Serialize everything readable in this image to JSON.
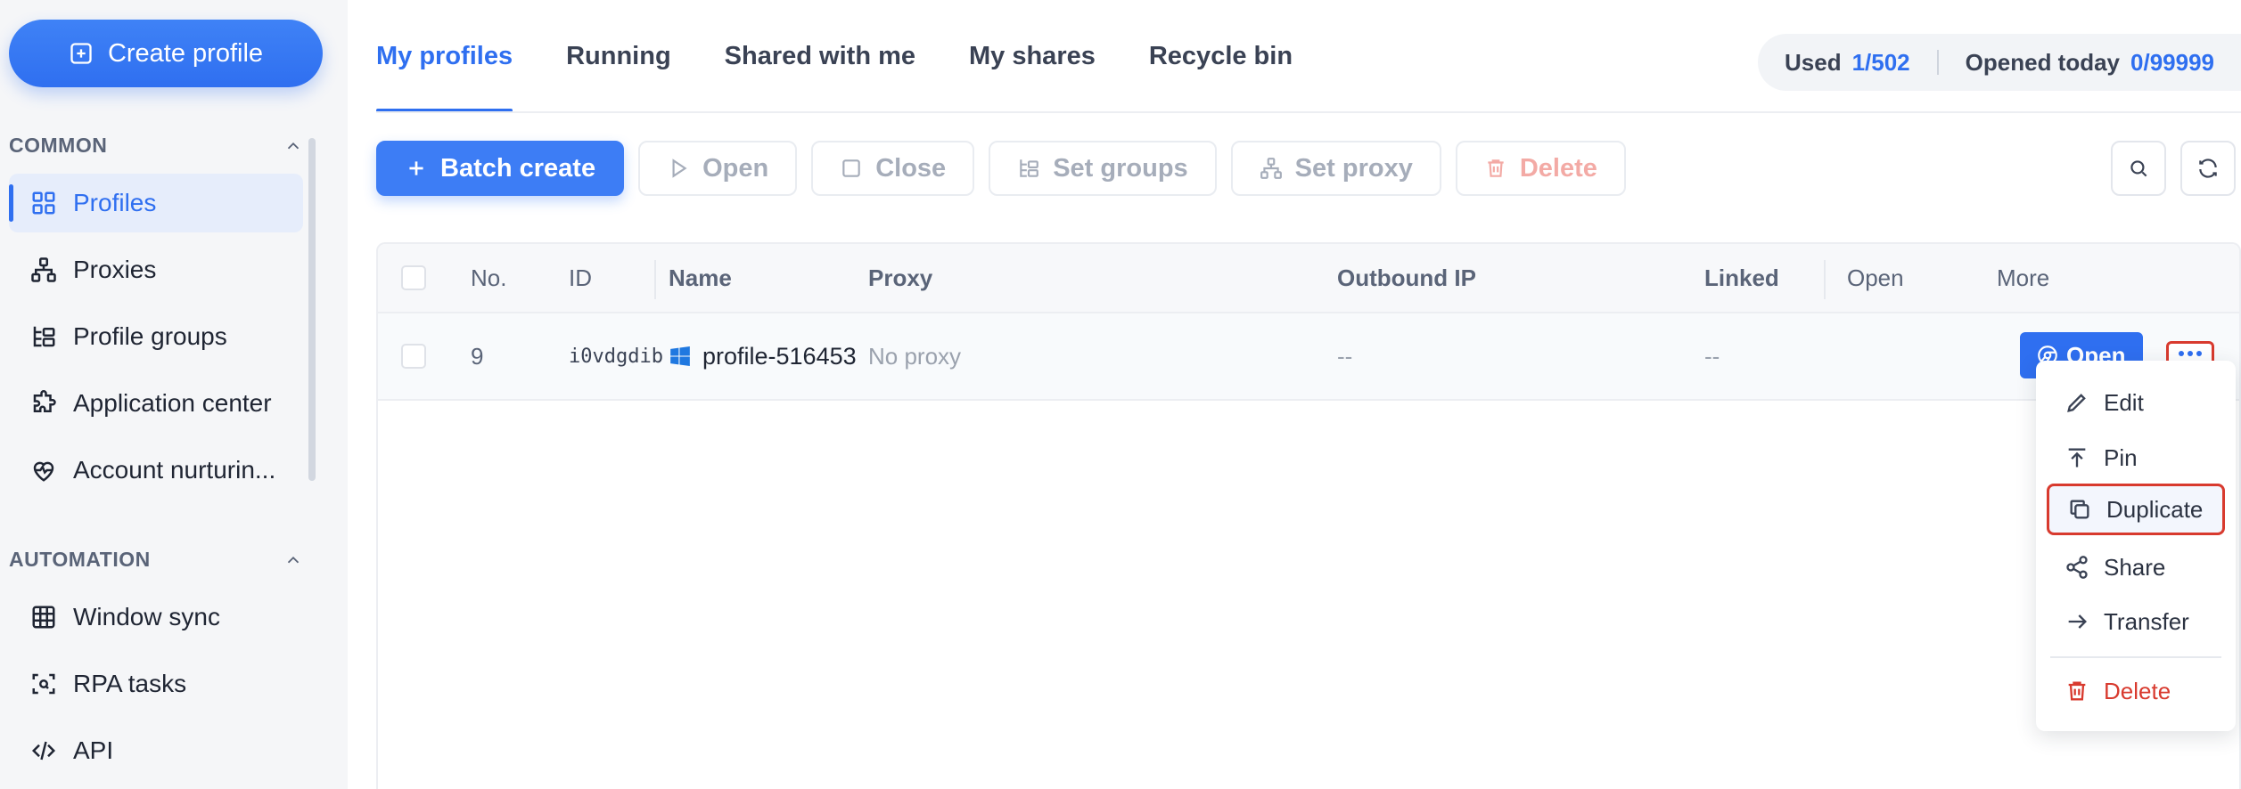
{
  "sidebar": {
    "create_label": "Create profile",
    "sections": [
      {
        "title": "COMMON",
        "items": [
          {
            "label": "Profiles",
            "icon": "grid-icon",
            "active": true
          },
          {
            "label": "Proxies",
            "icon": "network-icon"
          },
          {
            "label": "Profile groups",
            "icon": "groups-icon"
          },
          {
            "label": "Application center",
            "icon": "puzzle-icon"
          },
          {
            "label": "Account nurturin...",
            "icon": "heart-pulse-icon"
          }
        ]
      },
      {
        "title": "AUTOMATION",
        "items": [
          {
            "label": "Window sync",
            "icon": "window-grid-icon"
          },
          {
            "label": "RPA tasks",
            "icon": "scan-icon"
          },
          {
            "label": "API",
            "icon": "code-icon"
          }
        ]
      }
    ]
  },
  "tabs": [
    "My profiles",
    "Running",
    "Shared with me",
    "My shares",
    "Recycle bin"
  ],
  "usage": {
    "used_label": "Used",
    "used_value": "1/502",
    "opened_label": "Opened today",
    "opened_value": "0/99999"
  },
  "toolbar": {
    "batch_create": "Batch create",
    "open": "Open",
    "close": "Close",
    "set_groups": "Set groups",
    "set_proxy": "Set proxy",
    "delete": "Delete"
  },
  "table": {
    "columns": {
      "no": "No.",
      "id": "ID",
      "name": "Name",
      "proxy": "Proxy",
      "outbound_ip": "Outbound IP",
      "linked": "Linked",
      "open": "Open",
      "more": "More"
    },
    "rows": [
      {
        "no": "9",
        "id": "i0vdgdib",
        "name": "profile-516453",
        "proxy": "No proxy",
        "outbound_ip": "--",
        "linked": "--",
        "open_label": "Open"
      }
    ]
  },
  "more_menu": {
    "items": [
      {
        "label": "Edit",
        "icon": "pencil-icon"
      },
      {
        "label": "Pin",
        "icon": "pin-top-icon"
      },
      {
        "label": "Duplicate",
        "icon": "copy-icon"
      },
      {
        "label": "Share",
        "icon": "share-icon"
      },
      {
        "label": "Transfer",
        "icon": "arrow-right-icon"
      },
      {
        "label": "Delete",
        "icon": "trash-icon"
      }
    ]
  },
  "colors": {
    "accent": "#2f6ff0",
    "danger": "#d83a2e"
  }
}
